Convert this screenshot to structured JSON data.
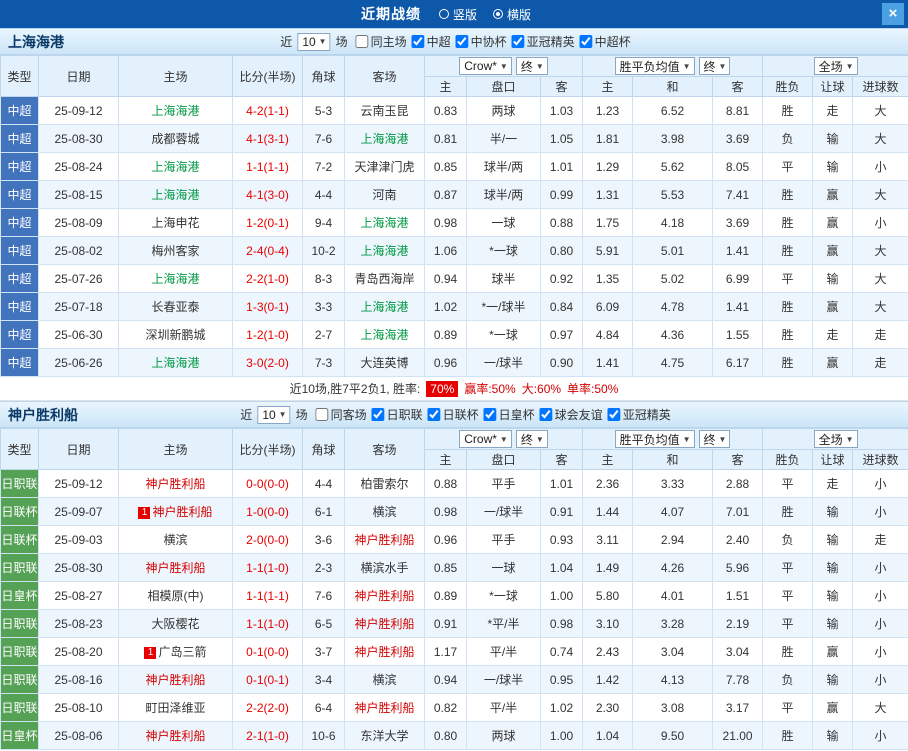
{
  "top_bar": {
    "title": "近期战绩",
    "close_glyph": "×",
    "options": [
      {
        "label": "竖版",
        "selected": false
      },
      {
        "label": "横版",
        "selected": true
      }
    ]
  },
  "colors": {
    "csl_blue": "#4274bd",
    "jp_green": "#55a155",
    "score_red": "#e60000",
    "result_red": "#e60000",
    "result_blue": "#0a6cd6",
    "win_rate_badge": "#e60000"
  },
  "sections": [
    {
      "team": "上海海港",
      "focal_color": "#009944",
      "filters": {
        "prefix": "近",
        "count": "10",
        "suffix": "场",
        "checkboxes": [
          {
            "label": "同主场",
            "checked": false
          },
          {
            "label": "中超",
            "checked": true
          },
          {
            "label": "中协杯",
            "checked": true
          },
          {
            "label": "亚冠精英",
            "checked": true
          },
          {
            "label": "中超杯",
            "checked": true
          }
        ]
      },
      "odds_dropdowns": {
        "group1": [
          "Crow*",
          "终"
        ],
        "group2": [
          "胜平负均值",
          "终"
        ],
        "group3": [
          "全场"
        ]
      },
      "columns": [
        "类型",
        "日期",
        "主场",
        "比分(半场)",
        "角球",
        "客场",
        "主",
        "盘口",
        "客",
        "主",
        "和",
        "客",
        "胜负",
        "让球",
        "进球数"
      ],
      "rows": [
        {
          "type": "中超",
          "date": "25-09-12",
          "home": "上海海港",
          "focal": "home",
          "score": "4-2(1-1)",
          "corners": "5-3",
          "away": "云南玉昆",
          "odds": [
            "0.83",
            "两球",
            "1.03"
          ],
          "avg": [
            "1.23",
            "6.52",
            "8.81"
          ],
          "results": [
            "胜",
            "走",
            "大"
          ]
        },
        {
          "type": "中超",
          "date": "25-08-30",
          "home": "成都蓉城",
          "focal": "away",
          "score": "4-1(3-1)",
          "corners": "7-6",
          "away": "上海海港",
          "odds": [
            "0.81",
            "半/一",
            "1.05"
          ],
          "avg": [
            "1.81",
            "3.98",
            "3.69"
          ],
          "results": [
            "负",
            "输",
            "大"
          ]
        },
        {
          "type": "中超",
          "date": "25-08-24",
          "home": "上海海港",
          "focal": "home",
          "score": "1-1(1-1)",
          "corners": "7-2",
          "away": "天津津门虎",
          "odds": [
            "0.85",
            "球半/两",
            "1.01"
          ],
          "avg": [
            "1.29",
            "5.62",
            "8.05"
          ],
          "results": [
            "平",
            "输",
            "小"
          ]
        },
        {
          "type": "中超",
          "date": "25-08-15",
          "home": "上海海港",
          "focal": "home",
          "score": "4-1(3-0)",
          "corners": "4-4",
          "away": "河南",
          "odds": [
            "0.87",
            "球半/两",
            "0.99"
          ],
          "avg": [
            "1.31",
            "5.53",
            "7.41"
          ],
          "results": [
            "胜",
            "赢",
            "大"
          ]
        },
        {
          "type": "中超",
          "date": "25-08-09",
          "home": "上海申花",
          "focal": "away",
          "score": "1-2(0-1)",
          "corners": "9-4",
          "away": "上海海港",
          "odds": [
            "0.98",
            "一球",
            "0.88"
          ],
          "avg": [
            "1.75",
            "4.18",
            "3.69"
          ],
          "results": [
            "胜",
            "赢",
            "小"
          ]
        },
        {
          "type": "中超",
          "date": "25-08-02",
          "home": "梅州客家",
          "focal": "away",
          "score": "2-4(0-4)",
          "corners": "10-2",
          "away": "上海海港",
          "odds": [
            "1.06",
            "*一球",
            "0.80"
          ],
          "avg": [
            "5.91",
            "5.01",
            "1.41"
          ],
          "results": [
            "胜",
            "赢",
            "大"
          ]
        },
        {
          "type": "中超",
          "date": "25-07-26",
          "home": "上海海港",
          "focal": "home",
          "score": "2-2(1-0)",
          "corners": "8-3",
          "away": "青岛西海岸",
          "odds": [
            "0.94",
            "球半",
            "0.92"
          ],
          "avg": [
            "1.35",
            "5.02",
            "6.99"
          ],
          "results": [
            "平",
            "输",
            "大"
          ]
        },
        {
          "type": "中超",
          "date": "25-07-18",
          "home": "长春亚泰",
          "focal": "away",
          "score": "1-3(0-1)",
          "corners": "3-3",
          "away": "上海海港",
          "odds": [
            "1.02",
            "*一/球半",
            "0.84"
          ],
          "avg": [
            "6.09",
            "4.78",
            "1.41"
          ],
          "results": [
            "胜",
            "赢",
            "大"
          ]
        },
        {
          "type": "中超",
          "date": "25-06-30",
          "home": "深圳新鹏城",
          "focal": "away",
          "score": "1-2(1-0)",
          "corners": "2-7",
          "away": "上海海港",
          "odds": [
            "0.89",
            "*一球",
            "0.97"
          ],
          "avg": [
            "4.84",
            "4.36",
            "1.55"
          ],
          "results": [
            "胜",
            "走",
            "走"
          ]
        },
        {
          "type": "中超",
          "date": "25-06-26",
          "home": "上海海港",
          "focal": "home",
          "score": "3-0(2-0)",
          "corners": "7-3",
          "away": "大连英博",
          "odds": [
            "0.96",
            "一/球半",
            "0.90"
          ],
          "avg": [
            "1.41",
            "4.75",
            "6.17"
          ],
          "results": [
            "胜",
            "赢",
            "走"
          ]
        }
      ],
      "summary": {
        "prefix": "近10场,胜7平2负1, 胜率:",
        "win_rate": "70%",
        "stats": [
          "赢率:50%",
          "大:60%",
          "单率:50%"
        ]
      }
    },
    {
      "team": "神户胜利船",
      "focal_color": "#d40000",
      "filters": {
        "prefix": "近",
        "count": "10",
        "suffix": "场",
        "checkboxes": [
          {
            "label": "同客场",
            "checked": false
          },
          {
            "label": "日职联",
            "checked": true
          },
          {
            "label": "日联杯",
            "checked": true
          },
          {
            "label": "日皇杯",
            "checked": true
          },
          {
            "label": "球会友谊",
            "checked": true
          },
          {
            "label": "亚冠精英",
            "checked": true
          }
        ]
      },
      "odds_dropdowns": {
        "group1": [
          "Crow*",
          "终"
        ],
        "group2": [
          "胜平负均值",
          "终"
        ],
        "group3": [
          "全场"
        ]
      },
      "columns": [
        "类型",
        "日期",
        "主场",
        "比分(半场)",
        "角球",
        "客场",
        "主",
        "盘口",
        "客",
        "主",
        "和",
        "客",
        "胜负",
        "让球",
        "进球数"
      ],
      "rows": [
        {
          "type": "日职联",
          "date": "25-09-12",
          "home": "神户胜利船",
          "focal": "home",
          "score": "0-0(0-0)",
          "corners": "4-4",
          "away": "柏雷索尔",
          "odds": [
            "0.88",
            "平手",
            "1.01"
          ],
          "avg": [
            "2.36",
            "3.33",
            "2.88"
          ],
          "results": [
            "平",
            "走",
            "小"
          ]
        },
        {
          "type": "日联杯",
          "date": "25-09-07",
          "home": "神户胜利船",
          "home_badge": "1",
          "focal": "home",
          "score": "1-0(0-0)",
          "corners": "6-1",
          "away": "横滨",
          "odds": [
            "0.98",
            "一/球半",
            "0.91"
          ],
          "avg": [
            "1.44",
            "4.07",
            "7.01"
          ],
          "results": [
            "胜",
            "输",
            "小"
          ]
        },
        {
          "type": "日联杯",
          "date": "25-09-03",
          "home": "横滨",
          "focal": "away",
          "score": "2-0(0-0)",
          "corners": "3-6",
          "away": "神户胜利船",
          "odds": [
            "0.96",
            "平手",
            "0.93"
          ],
          "avg": [
            "3.11",
            "2.94",
            "2.40"
          ],
          "results": [
            "负",
            "输",
            "走"
          ]
        },
        {
          "type": "日职联",
          "date": "25-08-30",
          "home": "神户胜利船",
          "focal": "home",
          "score": "1-1(1-0)",
          "corners": "2-3",
          "away": "横滨水手",
          "odds": [
            "0.85",
            "一球",
            "1.04"
          ],
          "avg": [
            "1.49",
            "4.26",
            "5.96"
          ],
          "results": [
            "平",
            "输",
            "小"
          ]
        },
        {
          "type": "日皇杯",
          "date": "25-08-27",
          "home": "相模原(中)",
          "focal": "away",
          "score": "1-1(1-1)",
          "corners": "7-6",
          "away": "神户胜利船",
          "odds": [
            "0.89",
            "*一球",
            "1.00"
          ],
          "avg": [
            "5.80",
            "4.01",
            "1.51"
          ],
          "results": [
            "平",
            "输",
            "小"
          ]
        },
        {
          "type": "日职联",
          "date": "25-08-23",
          "home": "大阪樱花",
          "focal": "away",
          "score": "1-1(1-0)",
          "corners": "6-5",
          "away": "神户胜利船",
          "odds": [
            "0.91",
            "*平/半",
            "0.98"
          ],
          "avg": [
            "3.10",
            "3.28",
            "2.19"
          ],
          "results": [
            "平",
            "输",
            "小"
          ]
        },
        {
          "type": "日职联",
          "date": "25-08-20",
          "home": "广岛三箭",
          "home_badge": "1",
          "focal": "away",
          "score": "0-1(0-0)",
          "corners": "3-7",
          "away": "神户胜利船",
          "odds": [
            "1.17",
            "平/半",
            "0.74"
          ],
          "avg": [
            "2.43",
            "3.04",
            "3.04"
          ],
          "results": [
            "胜",
            "赢",
            "小"
          ]
        },
        {
          "type": "日职联",
          "date": "25-08-16",
          "home": "神户胜利船",
          "focal": "home",
          "score": "0-1(0-1)",
          "corners": "3-4",
          "away": "横滨",
          "odds": [
            "0.94",
            "一/球半",
            "0.95"
          ],
          "avg": [
            "1.42",
            "4.13",
            "7.78"
          ],
          "results": [
            "负",
            "输",
            "小"
          ]
        },
        {
          "type": "日职联",
          "date": "25-08-10",
          "home": "町田泽维亚",
          "focal": "away",
          "score": "2-2(2-0)",
          "corners": "6-4",
          "away": "神户胜利船",
          "odds": [
            "0.82",
            "平/半",
            "1.02"
          ],
          "avg": [
            "2.30",
            "3.08",
            "3.17"
          ],
          "results": [
            "平",
            "赢",
            "大"
          ]
        },
        {
          "type": "日皇杯",
          "date": "25-08-06",
          "home": "神户胜利船",
          "focal": "home",
          "score": "2-1(1-0)",
          "corners": "10-6",
          "away": "东洋大学",
          "odds": [
            "0.80",
            "两球",
            "1.00"
          ],
          "avg": [
            "1.04",
            "9.50",
            "21.00"
          ],
          "results": [
            "胜",
            "输",
            "小"
          ]
        }
      ]
    }
  ]
}
